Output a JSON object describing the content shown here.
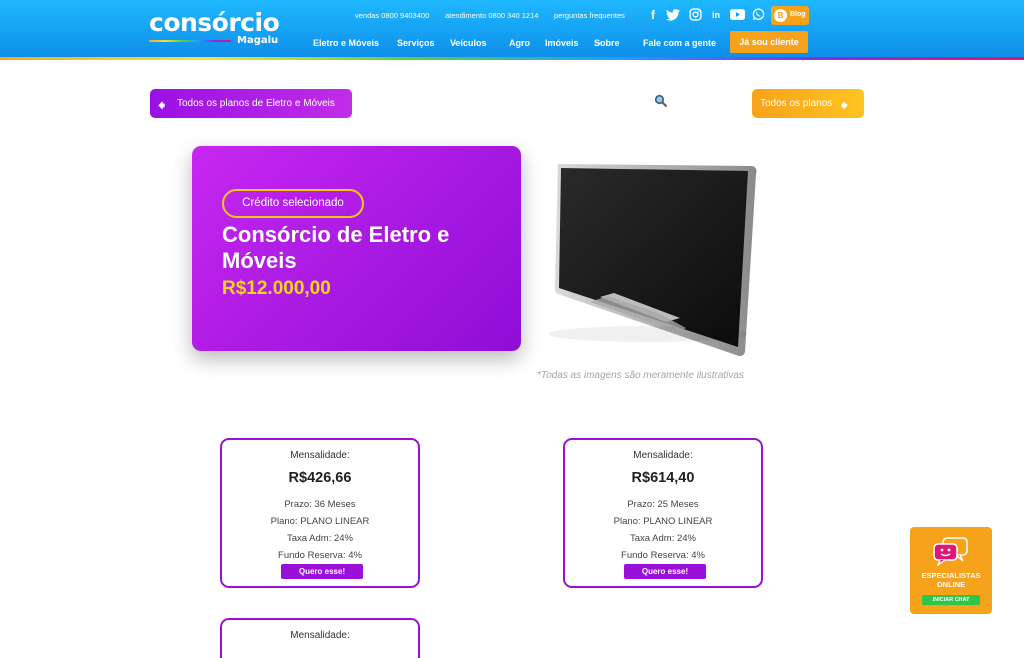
{
  "brand": {
    "logo_main": "consórcio",
    "logo_sub": "Magalu"
  },
  "top_links": {
    "sales": "vendas 0800 9403400",
    "support": "atendimento 0800 340 1214",
    "faq": "perguntas frequentes"
  },
  "social": {
    "facebook": "f",
    "twitter": "t",
    "linkedin": "in",
    "blog_label": "Blog"
  },
  "nav": {
    "items": [
      "Eletro e Móveis",
      "Serviços",
      "Veículos",
      "Agro",
      "Imóveis",
      "Sobre",
      "Fale com a gente"
    ],
    "client_button": "Já sou cliente"
  },
  "actions": {
    "back_label": "Todos os planos de Eletro e Móveis",
    "forward_label": "Todos os planos"
  },
  "hero": {
    "badge": "Crédito selecionado",
    "title": "Consórcio de Eletro e Móveis",
    "value": "R$12.000,00",
    "disclaimer": "*Todas as imagens são meramente ilustrativas"
  },
  "plans": [
    {
      "label": "Mensalidade:",
      "value": "R$426,66",
      "term": "Prazo: 36 Meses",
      "plan": "Plano: PLANO LINEAR",
      "fee": "Taxa Adm: 24%",
      "reserve": "Fundo Reserva: 4%",
      "button": "Quero esse!"
    },
    {
      "label": "Mensalidade:",
      "value": "R$614,40",
      "term": "Prazo: 25 Meses",
      "plan": "Plano: PLANO LINEAR",
      "fee": "Taxa Adm: 24%",
      "reserve": "Fundo Reserva: 4%",
      "button": "Quero esse!"
    },
    {
      "label": "Mensalidade:"
    }
  ],
  "chat": {
    "title": "ESPECIALISTAS ONLINE",
    "button": "INICIAR CHAT"
  },
  "colors": {
    "header": "#1fa8f5",
    "purple": "#9a10e4",
    "orange": "#f7a21b",
    "value_yellow": "#f7d51a",
    "chat_green": "#2fc44a"
  }
}
